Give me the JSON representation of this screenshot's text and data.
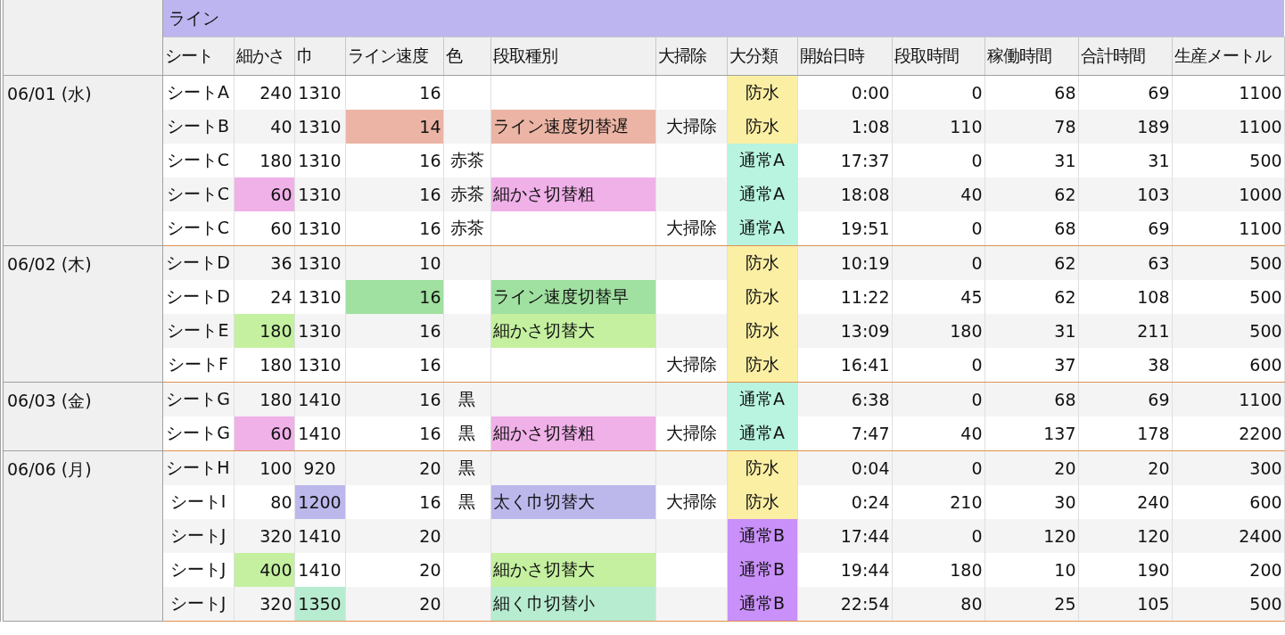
{
  "band": "ライン",
  "columns": [
    "シート",
    "細かさ",
    "巾",
    "ライン速度",
    "色",
    "段取種別",
    "大掃除",
    "大分類",
    "開始日時",
    "段取時間",
    "稼働時間",
    "合計時間",
    "生産メートル"
  ],
  "groups": [
    {
      "date": "06/01 (水)",
      "rows": [
        {
          "cells": [
            "シートA",
            "240",
            "1310",
            "16",
            "",
            "",
            "",
            {
              "text": "防水",
              "color": "#fbefa4"
            },
            "0:00",
            "0",
            "68",
            "69",
            "1100"
          ]
        },
        {
          "cells": [
            "シートB",
            "40",
            "1310",
            {
              "text": "14",
              "color": "#ebb4a4"
            },
            "",
            {
              "text": "ライン速度切替遅",
              "color": "#ebb4a4"
            },
            "大掃除",
            {
              "text": "防水",
              "color": "#fbefa4"
            },
            "1:08",
            "110",
            "78",
            "189",
            "1100"
          ]
        },
        {
          "cells": [
            "シートC",
            "180",
            "1310",
            "16",
            "赤茶",
            "",
            "",
            {
              "text": "通常A",
              "color": "#b8f4e0"
            },
            "17:37",
            "0",
            "31",
            "31",
            "500"
          ]
        },
        {
          "cells": [
            "シートC",
            {
              "text": "60",
              "color": "#f0b0e8"
            },
            "1310",
            "16",
            "赤茶",
            {
              "text": "細かさ切替粗",
              "color": "#f0b0e8"
            },
            "",
            {
              "text": "通常A",
              "color": "#b8f4e0"
            },
            "18:08",
            "40",
            "62",
            "103",
            "1000"
          ]
        },
        {
          "cells": [
            "シートC",
            "60",
            "1310",
            "16",
            "赤茶",
            "",
            "大掃除",
            {
              "text": "通常A",
              "color": "#b8f4e0"
            },
            "19:51",
            "0",
            "68",
            "69",
            "1100"
          ]
        }
      ]
    },
    {
      "date": "06/02 (木)",
      "rows": [
        {
          "cells": [
            "シートD",
            "36",
            "1310",
            "10",
            "",
            "",
            "",
            {
              "text": "防水",
              "color": "#fbefa4"
            },
            "10:19",
            "0",
            "62",
            "63",
            "500"
          ]
        },
        {
          "cells": [
            "シートD",
            "24",
            "1310",
            {
              "text": "16",
              "color": "#a0e0a0"
            },
            "",
            {
              "text": "ライン速度切替早",
              "color": "#a0e0a0"
            },
            "",
            {
              "text": "防水",
              "color": "#fbefa4"
            },
            "11:22",
            "45",
            "62",
            "108",
            "500"
          ]
        },
        {
          "cells": [
            "シートE",
            {
              "text": "180",
              "color": "#c4f0a0"
            },
            "1310",
            "16",
            "",
            {
              "text": "細かさ切替大",
              "color": "#c4f0a0"
            },
            "",
            {
              "text": "防水",
              "color": "#fbefa4"
            },
            "13:09",
            "180",
            "31",
            "211",
            "500"
          ]
        },
        {
          "cells": [
            "シートF",
            "180",
            "1310",
            "16",
            "",
            "",
            "大掃除",
            {
              "text": "防水",
              "color": "#fbefa4"
            },
            "16:41",
            "0",
            "37",
            "38",
            "600"
          ]
        }
      ]
    },
    {
      "date": "06/03 (金)",
      "rows": [
        {
          "cells": [
            "シートG",
            "180",
            "1410",
            "16",
            "黒",
            "",
            "",
            {
              "text": "通常A",
              "color": "#b8f4e0"
            },
            "6:38",
            "0",
            "68",
            "69",
            "1100"
          ]
        },
        {
          "cells": [
            "シートG",
            {
              "text": "60",
              "color": "#f0b0e8"
            },
            "1410",
            "16",
            "黒",
            {
              "text": "細かさ切替粗",
              "color": "#f0b0e8"
            },
            "大掃除",
            {
              "text": "通常A",
              "color": "#b8f4e0"
            },
            "7:47",
            "40",
            "137",
            "178",
            "2200"
          ]
        }
      ]
    },
    {
      "date": "06/06 (月)",
      "rows": [
        {
          "cells": [
            "シートH",
            "100",
            "920",
            "20",
            "黒",
            "",
            "",
            {
              "text": "防水",
              "color": "#fbefa4"
            },
            "0:04",
            "0",
            "20",
            "20",
            "300"
          ]
        },
        {
          "cells": [
            "シートI",
            "80",
            {
              "text": "1200",
              "color": "#bcb8ec"
            },
            "16",
            "黒",
            {
              "text": "太く巾切替大",
              "color": "#bcb8ec"
            },
            "大掃除",
            {
              "text": "防水",
              "color": "#fbefa4"
            },
            "0:24",
            "210",
            "30",
            "240",
            "600"
          ]
        },
        {
          "cells": [
            "シートJ",
            "320",
            "1410",
            "20",
            "",
            "",
            "",
            {
              "text": "通常B",
              "color": "#c890f8"
            },
            "17:44",
            "0",
            "120",
            "120",
            "2400"
          ]
        },
        {
          "cells": [
            "シートJ",
            {
              "text": "400",
              "color": "#c4f0a0"
            },
            "1410",
            "20",
            "",
            {
              "text": "細かさ切替大",
              "color": "#c4f0a0"
            },
            "",
            {
              "text": "通常B",
              "color": "#c890f8"
            },
            "19:44",
            "180",
            "10",
            "190",
            "200"
          ]
        },
        {
          "cells": [
            "シートJ",
            "320",
            {
              "text": "1350",
              "color": "#b8ecd0"
            },
            "20",
            "",
            {
              "text": "細く巾切替小",
              "color": "#b8ecd0"
            },
            "",
            {
              "text": "通常B",
              "color": "#c890f8"
            },
            "22:54",
            "80",
            "25",
            "105",
            "500"
          ]
        }
      ]
    }
  ]
}
